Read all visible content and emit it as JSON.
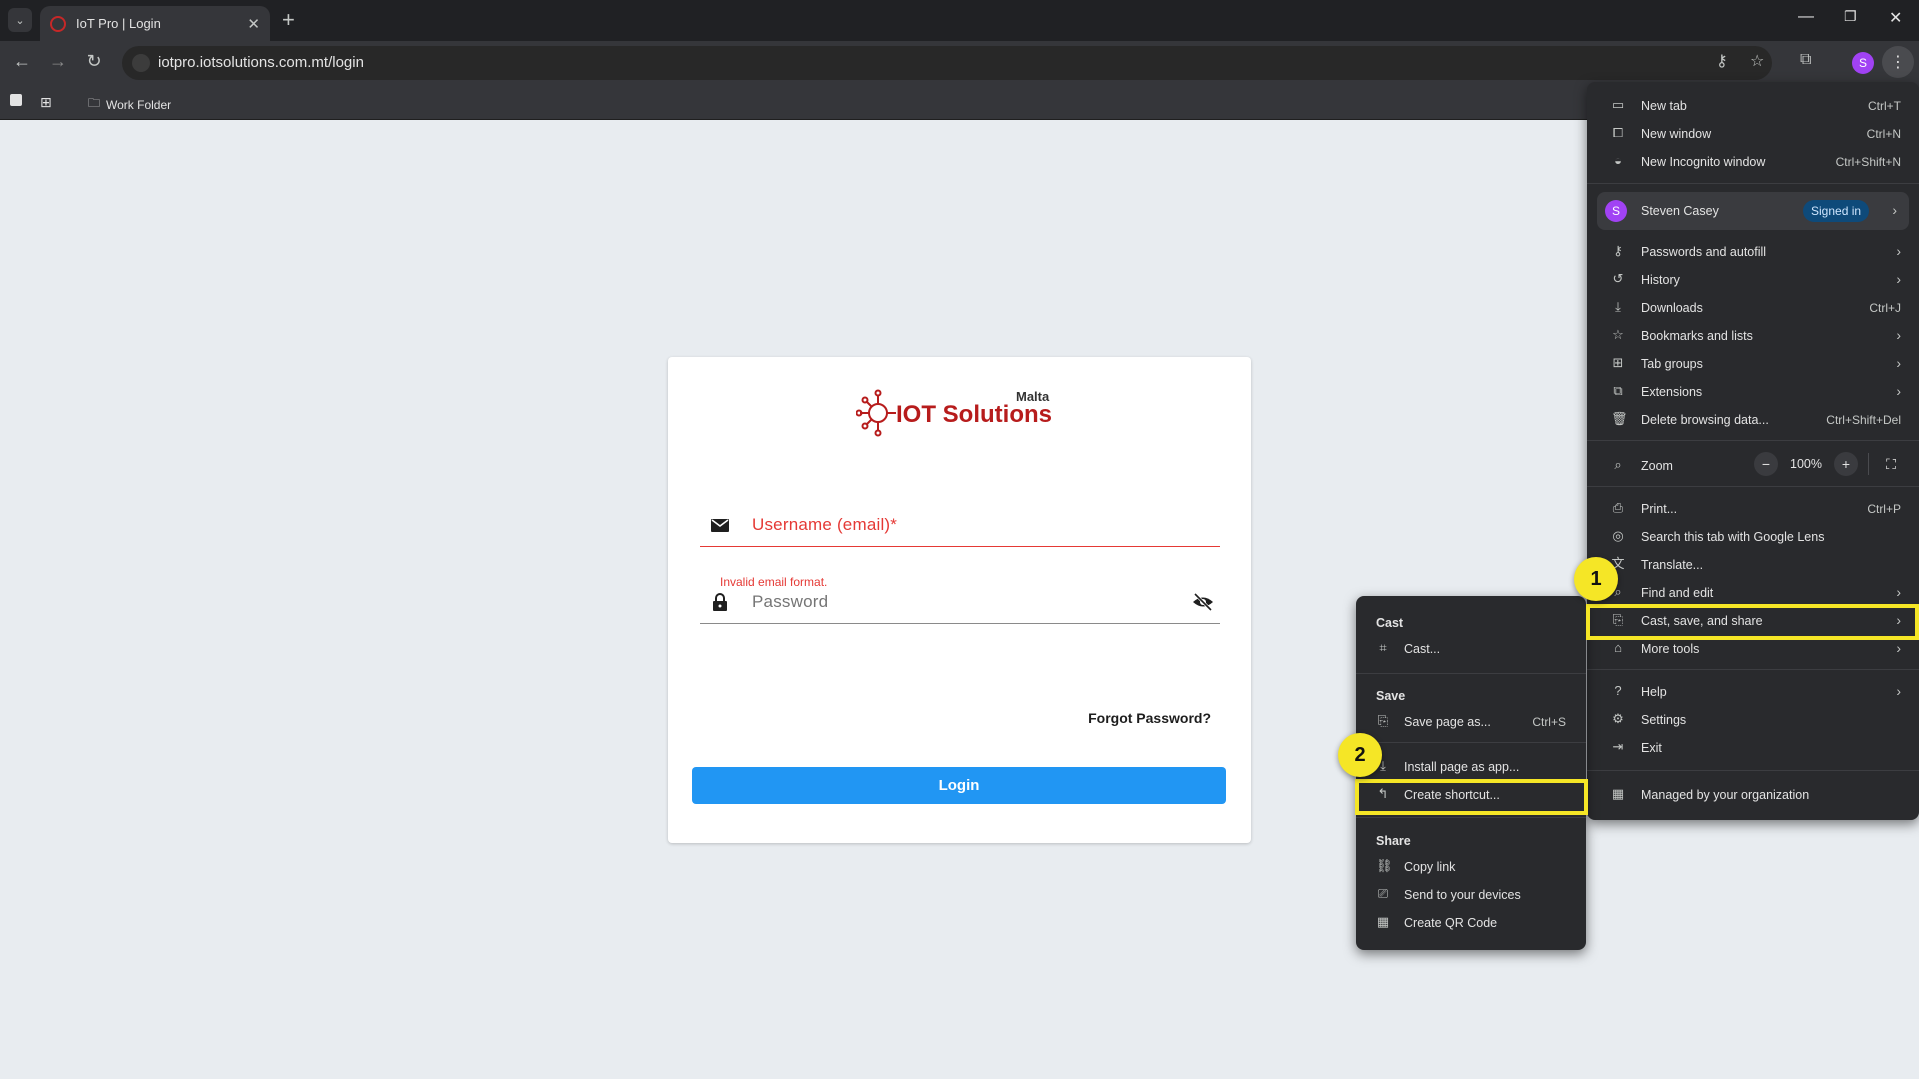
{
  "browser": {
    "tab_title": "IoT Pro | Login",
    "url": "iotpro.iotsolutions.com.mt/login",
    "profile_initial": "S",
    "bookmarks": [
      {
        "label": "Work Folder"
      }
    ]
  },
  "login": {
    "logo_text_main": "IOT Solutions",
    "logo_text_small": "Malta",
    "username_label": "Username (email)*",
    "username_error": "Invalid email format.",
    "password_label": "Password",
    "forgot": "Forgot Password?",
    "login_button": "Login"
  },
  "menu": {
    "new_tab": {
      "label": "New tab",
      "shortcut": "Ctrl+T"
    },
    "new_window": {
      "label": "New window",
      "shortcut": "Ctrl+N"
    },
    "incognito": {
      "label": "New Incognito window",
      "shortcut": "Ctrl+Shift+N"
    },
    "profile": {
      "initial": "S",
      "name": "Steven Casey",
      "badge": "Signed in"
    },
    "passwords": {
      "label": "Passwords and autofill"
    },
    "history": {
      "label": "History"
    },
    "downloads": {
      "label": "Downloads",
      "shortcut": "Ctrl+J"
    },
    "bookmarks": {
      "label": "Bookmarks and lists"
    },
    "tab_groups": {
      "label": "Tab groups"
    },
    "extensions": {
      "label": "Extensions"
    },
    "delete_data": {
      "label": "Delete browsing data...",
      "shortcut": "Ctrl+Shift+Del"
    },
    "zoom": {
      "label": "Zoom",
      "value": "100%"
    },
    "print": {
      "label": "Print...",
      "shortcut": "Ctrl+P"
    },
    "lens": {
      "label": "Search this tab with Google Lens"
    },
    "translate": {
      "label": "Translate..."
    },
    "find": {
      "label": "Find and edit"
    },
    "cast": {
      "label": "Cast, save, and share"
    },
    "more_tools": {
      "label": "More tools"
    },
    "help": {
      "label": "Help"
    },
    "settings": {
      "label": "Settings"
    },
    "exit": {
      "label": "Exit"
    },
    "managed": {
      "label": "Managed by your organization"
    }
  },
  "submenu": {
    "cast_header": "Cast",
    "cast": "Cast...",
    "save_header": "Save",
    "save_page": {
      "label": "Save page as...",
      "shortcut": "Ctrl+S"
    },
    "install": "Install page as app...",
    "shortcut": "Create shortcut...",
    "share_header": "Share",
    "copy_link": "Copy link",
    "send": "Send to your devices",
    "qr": "Create QR Code"
  },
  "annotations": {
    "step1": "1",
    "step2": "2",
    "color": "#f5e626"
  }
}
